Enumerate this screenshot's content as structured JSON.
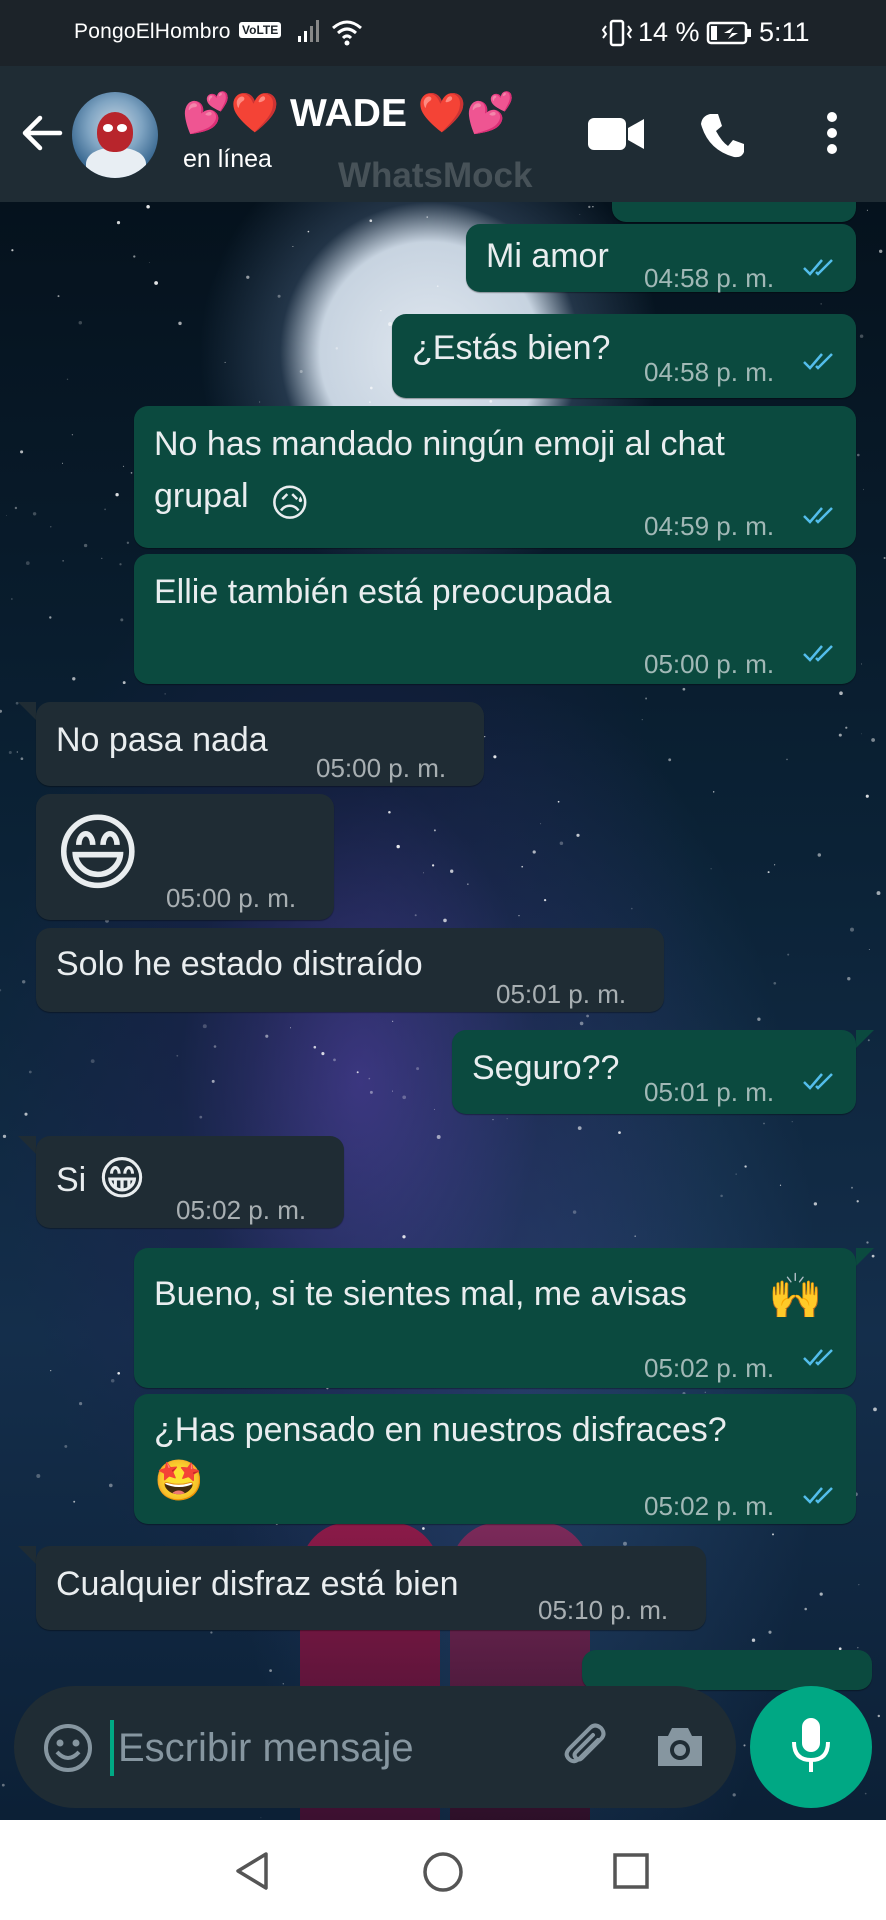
{
  "status_bar": {
    "carrier": "PongoElHombro",
    "volte": "VoLTE",
    "battery_percent": "14 %",
    "time": "5:11"
  },
  "header": {
    "contact_name": "💕❤️ WADE ❤️💕",
    "status": "en línea",
    "watermark": "WhatsMock",
    "icons": [
      "back-arrow-icon",
      "video-call-icon",
      "phone-icon",
      "more-options-icon"
    ]
  },
  "messages": [
    {
      "dir": "out",
      "text": "Mi amor",
      "time": "04:58 p. m.",
      "read": true
    },
    {
      "dir": "out",
      "text": "¿Estás bien?",
      "time": "04:58 p. m.",
      "read": true
    },
    {
      "dir": "out",
      "text_line1": "No has mandado ningún emoji al chat",
      "text_line2": "grupal",
      "emoji": "😥",
      "time": "04:59 p. m.",
      "read": true
    },
    {
      "dir": "out",
      "text": "Ellie también está preocupada",
      "time": "05:00 p. m.",
      "read": true
    },
    {
      "dir": "in",
      "text": "No pasa nada",
      "time": "05:00 p. m."
    },
    {
      "dir": "in",
      "emoji": "😄",
      "time": "05:00 p. m."
    },
    {
      "dir": "in",
      "text": "Solo he estado distraído",
      "time": "05:01 p. m."
    },
    {
      "dir": "out",
      "text": "Seguro??",
      "time": "05:01 p. m.",
      "read": true
    },
    {
      "dir": "in",
      "text": "Si",
      "emoji": "😁",
      "time": "05:02 p. m."
    },
    {
      "dir": "out",
      "text": "Bueno, si te sientes mal, me avisas",
      "emoji": "🙌",
      "time": "05:02 p. m.",
      "read": true
    },
    {
      "dir": "out",
      "text": "¿Has pensado en nuestros disfraces?",
      "emoji": "🤩",
      "time": "05:02 p. m.",
      "read": true
    },
    {
      "dir": "in",
      "text": "Cualquier disfraz está bien",
      "time": "05:10 p. m."
    }
  ],
  "composer": {
    "placeholder": "Escribir mensaje",
    "icons": [
      "emoji-icon",
      "attach-icon",
      "camera-icon",
      "mic-icon"
    ]
  },
  "nav_bar": {
    "icons": [
      "nav-back-icon",
      "nav-home-icon",
      "nav-recent-icon"
    ]
  },
  "colors": {
    "outgoing_bubble": "#0b4a3f",
    "incoming_bubble": "#1f2c34",
    "header": "#1f2c34",
    "accent": "#00a884",
    "read_tick": "#53bdeb"
  }
}
